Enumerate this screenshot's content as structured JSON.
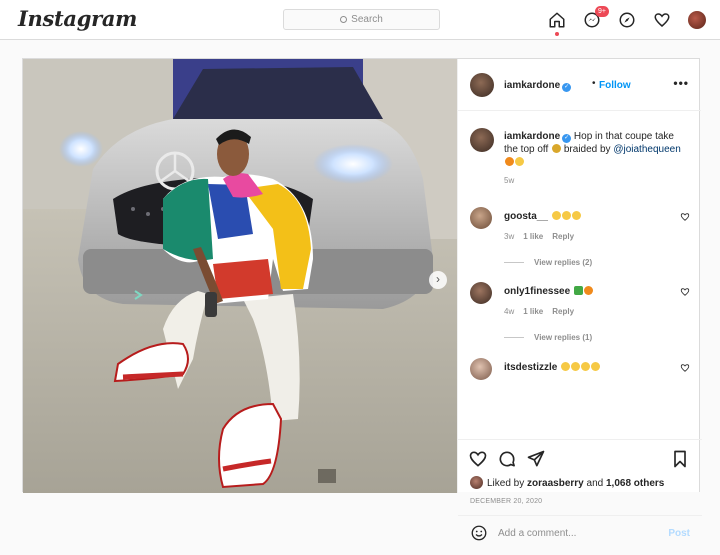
{
  "nav": {
    "logo": "Instagram",
    "search_placeholder": "Search",
    "notification_badge": "9+"
  },
  "post": {
    "author": "iamkardone",
    "follow_label": "Follow",
    "separator": "•",
    "more_label": "•••",
    "next_arrow": "›",
    "caption": {
      "username": "iamkardone",
      "text": "Hop in that coupe take the top off",
      "text_2": "braided by",
      "mention": "@joiathequeen",
      "time": "5w"
    },
    "comments": [
      {
        "username": "goosta__",
        "time": "3w",
        "likes": "1 like",
        "reply": "Reply",
        "view_replies": "View replies (2)"
      },
      {
        "username": "only1finessee",
        "time": "4w",
        "likes": "1 like",
        "reply": "Reply",
        "view_replies": "View replies (1)"
      },
      {
        "username": "itsdestizzle"
      }
    ],
    "likes": {
      "prefix": "Liked by",
      "user": "zoraasberry",
      "middle": "and",
      "count": "1,068 others"
    },
    "date": "DECEMBER 20, 2020",
    "add_comment_placeholder": "Add a comment...",
    "post_button": "Post"
  },
  "colors": {
    "accent": "#0095f6",
    "badge": "#ed4956",
    "verified": "#3897f0"
  }
}
